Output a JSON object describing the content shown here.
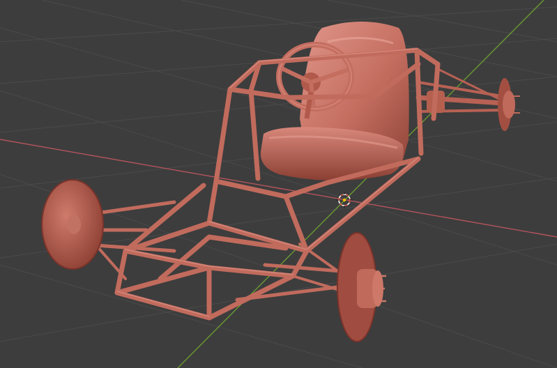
{
  "viewport": {
    "background": "#3d3d3d",
    "grid_color": "#4a4a4a",
    "x_axis_color": "#b3545c",
    "y_axis_color": "#6a9a32"
  },
  "model": {
    "material_color": "#c97466",
    "shadow_color": "#8e4236",
    "highlight_color": "#e2958a",
    "parts": [
      "seat",
      "steering-wheel",
      "frame",
      "front-left-wheel",
      "front-right-wheel",
      "rear-axle"
    ]
  },
  "origin_gizmo": {
    "ring_color": "#ffffff",
    "dash_color": "#d04a3a",
    "center_color": "#f2c200"
  }
}
